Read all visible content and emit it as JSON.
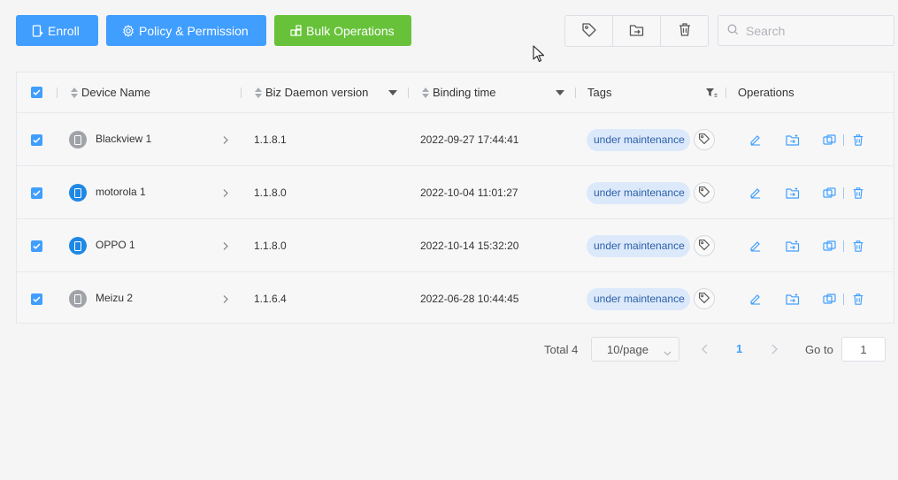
{
  "toolbar": {
    "enroll_label": "Enroll",
    "policy_label": "Policy & Permission",
    "bulk_label": "Bulk Operations",
    "icon_buttons": [
      "tag-icon",
      "folder-move-icon",
      "trash-icon"
    ]
  },
  "search": {
    "placeholder": "Search",
    "value": ""
  },
  "table": {
    "columns": {
      "device_name": "Device Name",
      "biz_daemon": "Biz Daemon version",
      "binding_time": "Binding time",
      "tags": "Tags",
      "operations": "Operations"
    },
    "rows": [
      {
        "checked": true,
        "device_name": "Blackview 1",
        "device_icon_color": "#a0a3a8",
        "version": "1.1.8.1",
        "binding_time": "2022-09-27 17:44:41",
        "tag": "under maintenance"
      },
      {
        "checked": true,
        "device_name": "motorola 1",
        "device_icon_color": "#1e88e5",
        "version": "1.1.8.0",
        "binding_time": "2022-10-04 11:01:27",
        "tag": "under maintenance"
      },
      {
        "checked": true,
        "device_name": "OPPO 1",
        "device_icon_color": "#1e88e5",
        "version": "1.1.8.0",
        "binding_time": "2022-10-14 15:32:20",
        "tag": "under maintenance"
      },
      {
        "checked": true,
        "device_name": "Meizu 2",
        "device_icon_color": "#a0a3a8",
        "version": "1.1.6.4",
        "binding_time": "2022-06-28 10:44:45",
        "tag": "under maintenance"
      }
    ]
  },
  "pagination": {
    "total_label": "Total 4",
    "page_size": "10/page",
    "current_page": "1",
    "goto_label": "Go to",
    "goto_value": "1"
  },
  "colors": {
    "primary": "#409eff",
    "success": "#67c23a",
    "tag_bg": "#dce9fb"
  }
}
